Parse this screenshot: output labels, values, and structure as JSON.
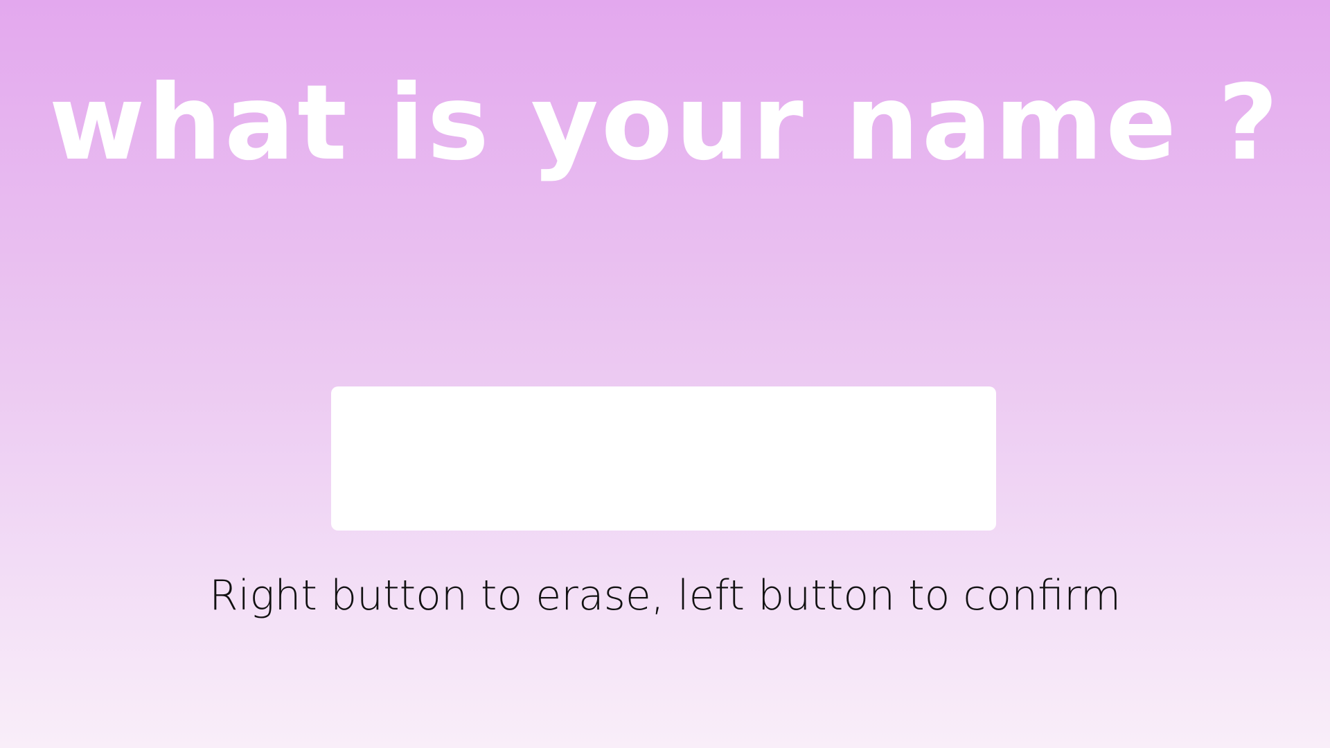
{
  "screen": {
    "title": "what is your name ?",
    "name_input": {
      "value": "",
      "placeholder": ""
    },
    "hint": "Right button to erase, left button to confirm"
  },
  "colors": {
    "background_top": "#e3a8ee",
    "background_bottom": "#f9eef9",
    "title_text": "#ffffff",
    "input_background": "#ffffff",
    "hint_text": "#111111"
  }
}
